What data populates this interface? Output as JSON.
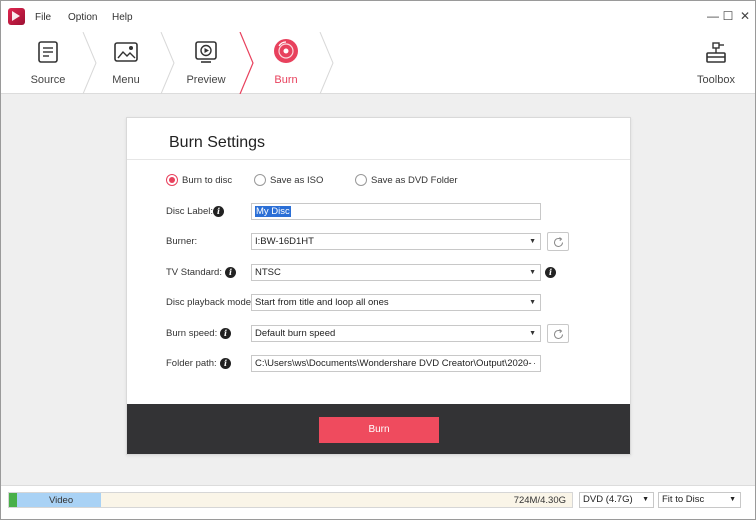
{
  "menu": [
    "File",
    "Option",
    "Help"
  ],
  "steps": [
    {
      "label": "Source",
      "icon": "source-icon"
    },
    {
      "label": "Menu",
      "icon": "menu-template-icon"
    },
    {
      "label": "Preview",
      "icon": "preview-icon"
    },
    {
      "label": "Burn",
      "icon": "burn-disc-icon",
      "active": true
    }
  ],
  "toolbox": {
    "label": "Toolbox",
    "icon": "toolbox-icon"
  },
  "dialog": {
    "title": "Burn Settings",
    "output_options": [
      "Burn to disc",
      "Save as ISO",
      "Save as DVD Folder"
    ],
    "selected_output": "Burn to disc",
    "fields": {
      "disc_label": {
        "label": "Disc Label:",
        "value": "My Disc"
      },
      "burner": {
        "label": "Burner:",
        "value": "I:BW-16D1HT"
      },
      "tv_standard": {
        "label": "TV Standard:",
        "value": "NTSC"
      },
      "playback_mode": {
        "label": "Disc playback mode:",
        "value": "Start from title and loop all ones"
      },
      "burn_speed": {
        "label": "Burn speed:",
        "value": "Default burn speed"
      },
      "folder_path": {
        "label": "Folder path:",
        "value": "C:\\Users\\ws\\Documents\\Wondershare DVD Creator\\Output\\2020-"
      }
    },
    "burn_button": "Burn"
  },
  "status": {
    "track_label": "Video",
    "size": "724M/4.30G",
    "used_fraction": 0.164,
    "disc_type": "DVD (4.7G)",
    "fit_mode": "Fit to Disc"
  },
  "colors": {
    "accent": "#ef4b5e",
    "footer": "#333335",
    "capacity_fill": "#a9d2f5"
  }
}
